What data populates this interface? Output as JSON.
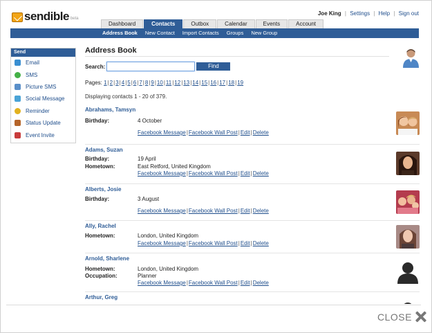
{
  "brand": {
    "name": "sendible",
    "tag": "beta"
  },
  "user": {
    "name": "Joe King",
    "links": [
      "Settings",
      "Help",
      "Sign out"
    ]
  },
  "tabs": [
    {
      "label": "Dashboard",
      "active": false
    },
    {
      "label": "Contacts",
      "active": true
    },
    {
      "label": "Outbox",
      "active": false
    },
    {
      "label": "Calendar",
      "active": false
    },
    {
      "label": "Events",
      "active": false
    },
    {
      "label": "Account",
      "active": false
    }
  ],
  "subnav": [
    "Address Book",
    "New Contact",
    "Import Contacts",
    "Groups",
    "New Group"
  ],
  "sidebar": {
    "heading": "Send",
    "items": [
      {
        "label": "Email",
        "icon": "email-icon",
        "color": "#3a8fd1"
      },
      {
        "label": "SMS",
        "icon": "sms-icon",
        "color": "#44b046"
      },
      {
        "label": "Picture SMS",
        "icon": "picture-sms-icon",
        "color": "#5a8fc9"
      },
      {
        "label": "Social Message",
        "icon": "social-message-icon",
        "color": "#4aa3d6"
      },
      {
        "label": "Reminder",
        "icon": "reminder-icon",
        "color": "#e2b11e"
      },
      {
        "label": "Status Update",
        "icon": "status-update-icon",
        "color": "#b5652a"
      },
      {
        "label": "Event Invite",
        "icon": "event-invite-icon",
        "color": "#c83c3c"
      }
    ]
  },
  "main": {
    "title": "Address Book",
    "search_label": "Search:",
    "search_value": "",
    "find_label": "Find",
    "pages_label": "Pages:",
    "pages": [
      "1",
      "2",
      "3",
      "4",
      "5",
      "6",
      "7",
      "8",
      "9",
      "10",
      "11",
      "12",
      "13",
      "14",
      "15",
      "16",
      "17",
      "18",
      "19"
    ],
    "displaying": "Displaying contacts 1 - 20 of 379."
  },
  "contacts": [
    {
      "name": "Abrahams, Tamsyn",
      "fields": [
        {
          "label": "Birthday:",
          "value": "4 October"
        }
      ],
      "photo": "couple"
    },
    {
      "name": "Adams, Suzan",
      "fields": [
        {
          "label": "Birthday:",
          "value": "19 April"
        },
        {
          "label": "Hometown:",
          "value": "East Retford, United Kingdom"
        }
      ],
      "photo": "woman-dark"
    },
    {
      "name": "Alberts, Josie",
      "fields": [
        {
          "label": "Birthday:",
          "value": "3 August"
        }
      ],
      "photo": "group"
    },
    {
      "name": "Ally, Rachel",
      "fields": [
        {
          "label": "Hometown:",
          "value": "London, United Kingdom"
        }
      ],
      "photo": "woman-light"
    },
    {
      "name": "Arnold, Sharlene",
      "fields": [
        {
          "label": "Hometown:",
          "value": "London, United Kingdom"
        },
        {
          "label": "Occupation:",
          "value": "Planner"
        }
      ],
      "photo": "silhouette"
    },
    {
      "name": "Arthur, Greg",
      "fields": [],
      "photo": "silhouette"
    }
  ],
  "actions": [
    "Facebook Message",
    "Facebook Wall Post",
    "Edit",
    "Delete"
  ],
  "close_label": "CLOSE"
}
